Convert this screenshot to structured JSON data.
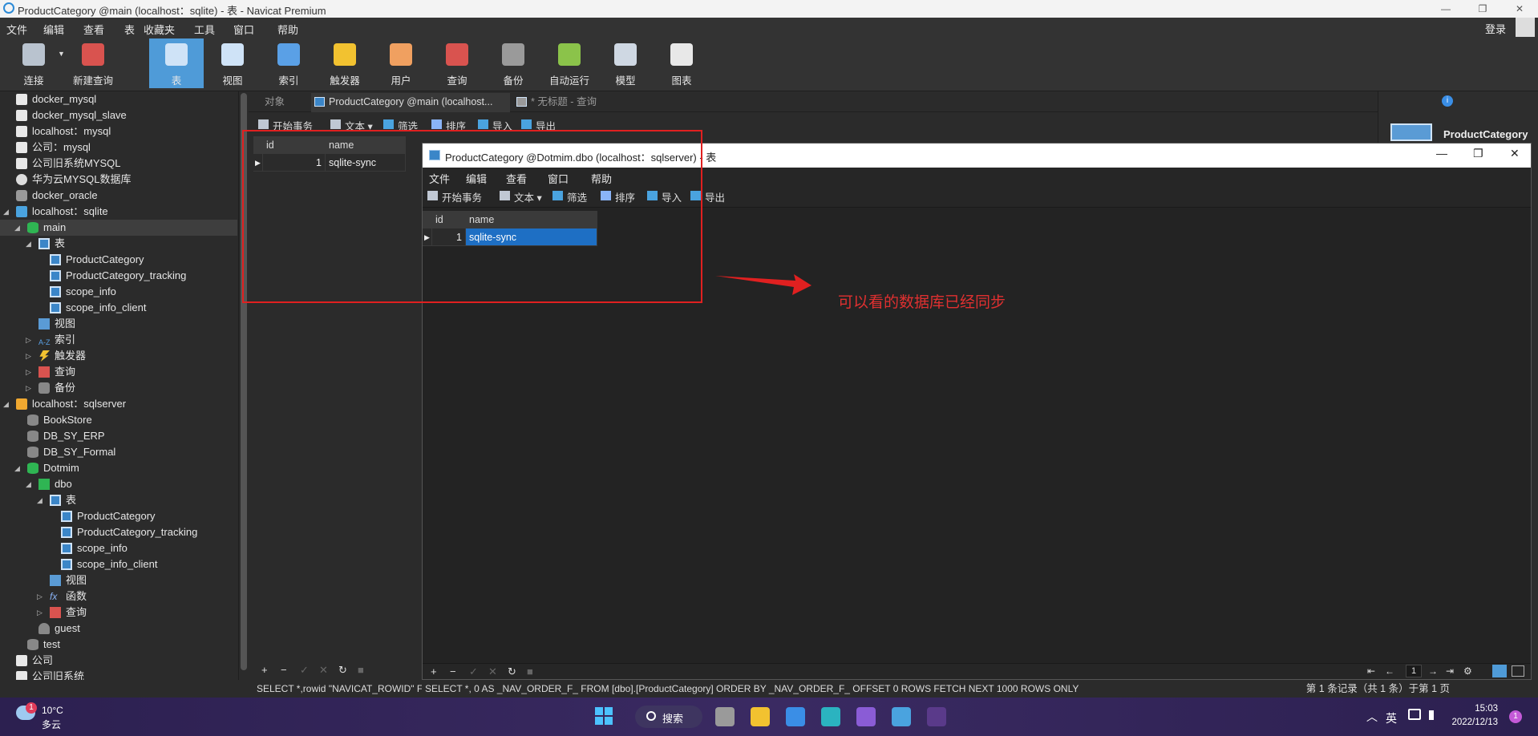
{
  "window": {
    "title": "ProductCategory @main (localhost：sqlite) - 表 - Navicat Premium",
    "minimize": "—",
    "maximize": "❐",
    "close": "✕"
  },
  "menu": [
    "文件",
    "编辑",
    "查看",
    "表",
    "收藏夹",
    "工具",
    "窗口",
    "帮助"
  ],
  "account": {
    "login": "登录"
  },
  "toolbar": [
    {
      "label": "连接",
      "icon": "plug-icon",
      "color": "#b9c3cf"
    },
    {
      "label": "新建查询",
      "icon": "new-query-icon",
      "color": "#d9534f"
    },
    {
      "label": "表",
      "icon": "table-icon",
      "color": "#cfe3f7",
      "active": true
    },
    {
      "label": "视图",
      "icon": "view-icon",
      "color": "#cfe3f7"
    },
    {
      "label": "索引",
      "icon": "index-icon",
      "color": "#5aa0e6"
    },
    {
      "label": "触发器",
      "icon": "trigger-icon",
      "color": "#f2c230"
    },
    {
      "label": "用户",
      "icon": "user-icon",
      "color": "#f0a060"
    },
    {
      "label": "查询",
      "icon": "query-icon",
      "color": "#d9534f"
    },
    {
      "label": "备份",
      "icon": "backup-icon",
      "color": "#9a9a9a"
    },
    {
      "label": "自动运行",
      "icon": "auto-run-icon",
      "color": "#8bc34a"
    },
    {
      "label": "模型",
      "icon": "model-icon",
      "color": "#cfd8e3"
    },
    {
      "label": "图表",
      "icon": "chart-icon",
      "color": "#e8e8e8"
    }
  ],
  "tree": [
    {
      "label": "docker_mysql",
      "icon": "conn",
      "indent": 0
    },
    {
      "label": "docker_mysql_slave",
      "icon": "conn",
      "indent": 0
    },
    {
      "label": "localhost：mysql",
      "icon": "conn",
      "indent": 0
    },
    {
      "label": "公司：mysql",
      "icon": "conn",
      "indent": 0
    },
    {
      "label": "公司旧系统MYSQL",
      "icon": "conn",
      "indent": 0
    },
    {
      "label": "华为云MYSQL数据库",
      "icon": "huawei",
      "indent": 0
    },
    {
      "label": "docker_oracle",
      "icon": "orcl",
      "indent": 0
    },
    {
      "label": "localhost：sqlite",
      "icon": "sqlite",
      "indent": 0,
      "arrow": "◢"
    },
    {
      "label": "main",
      "icon": "dbg",
      "indent": 1,
      "arrow": "◢",
      "selected": true
    },
    {
      "label": "表",
      "icon": "tbl",
      "indent": 2,
      "arrow": "◢"
    },
    {
      "label": "ProductCategory",
      "icon": "tbl",
      "indent": 3
    },
    {
      "label": "ProductCategory_tracking",
      "icon": "tbl",
      "indent": 3
    },
    {
      "label": "scope_info",
      "icon": "tbl",
      "indent": 3
    },
    {
      "label": "scope_info_client",
      "icon": "tbl",
      "indent": 3
    },
    {
      "label": "视图",
      "icon": "view",
      "indent": 2
    },
    {
      "label": "索引",
      "icon": "idx",
      "indent": 2,
      "arrow": "▷"
    },
    {
      "label": "触发器",
      "icon": "trig",
      "indent": 2,
      "arrow": "▷"
    },
    {
      "label": "查询",
      "icon": "query",
      "indent": 2,
      "arrow": "▷"
    },
    {
      "label": "备份",
      "icon": "backup",
      "indent": 2,
      "arrow": "▷"
    },
    {
      "label": "localhost：sqlserver",
      "icon": "sqlsrv",
      "indent": 0,
      "arrow": "◢"
    },
    {
      "label": "BookStore",
      "icon": "db",
      "indent": 1
    },
    {
      "label": "DB_SY_ERP",
      "icon": "db",
      "indent": 1
    },
    {
      "label": "DB_SY_Formal",
      "icon": "db",
      "indent": 1
    },
    {
      "label": "Dotmim",
      "icon": "dbg",
      "indent": 1,
      "arrow": "◢"
    },
    {
      "label": "dbo",
      "icon": "schema",
      "indent": 2,
      "arrow": "◢"
    },
    {
      "label": "表",
      "icon": "tbl",
      "indent": 3,
      "arrow": "◢"
    },
    {
      "label": "ProductCategory",
      "icon": "tbl",
      "indent": 4
    },
    {
      "label": "ProductCategory_tracking",
      "icon": "tbl",
      "indent": 4
    },
    {
      "label": "scope_info",
      "icon": "tbl",
      "indent": 4
    },
    {
      "label": "scope_info_client",
      "icon": "tbl",
      "indent": 4
    },
    {
      "label": "视图",
      "icon": "view",
      "indent": 3
    },
    {
      "label": "函数",
      "icon": "func",
      "indent": 3,
      "arrow": "▷"
    },
    {
      "label": "查询",
      "icon": "query",
      "indent": 3,
      "arrow": "▷"
    },
    {
      "label": "guest",
      "icon": "user",
      "indent": 2
    },
    {
      "label": "test",
      "icon": "db",
      "indent": 1
    },
    {
      "label": "公司",
      "icon": "conn",
      "indent": 0
    },
    {
      "label": "公司旧系统",
      "icon": "conn",
      "indent": 0
    }
  ],
  "tabs": [
    {
      "label": "对象",
      "active": false,
      "icon": false
    },
    {
      "label": "ProductCategory @main (localhost...",
      "active": true,
      "icon": true
    },
    {
      "label": "* 无标题 - 查询",
      "active": false,
      "icon": true
    }
  ],
  "subtoolbar": [
    "开始事务",
    "文本",
    "筛选",
    "排序",
    "导入",
    "导出"
  ],
  "grid_main": {
    "columns": [
      "id",
      "name"
    ],
    "rows": [
      [
        "1",
        "sqlite-sync"
      ]
    ]
  },
  "right_panel": {
    "title": "ProductCategory",
    "info": "i"
  },
  "subwindow": {
    "title": "ProductCategory @Dotmim.dbo (localhost：sqlserver) - 表",
    "menu": [
      "文件",
      "编辑",
      "查看",
      "窗口",
      "帮助"
    ],
    "toolbar": [
      "开始事务",
      "文本",
      "筛选",
      "排序",
      "导入",
      "导出"
    ],
    "grid": {
      "columns": [
        "id",
        "name"
      ],
      "rows": [
        [
          "1",
          "sqlite-sync"
        ]
      ]
    },
    "footer_buttons": [
      "+",
      "−",
      "✓",
      "✕",
      "↻",
      "■"
    ],
    "page": "1"
  },
  "annotation": {
    "text": "可以看的数据库已经同步",
    "color": "#e02020"
  },
  "status": {
    "left_sql": "SELECT *,rowid \"NAVICAT_ROWID\" FROM ...",
    "main_sql": "SELECT *, 0 AS _NAV_ORDER_F_ FROM [dbo].[ProductCategory] ORDER BY _NAV_ORDER_F_ OFFSET 0 ROWS FETCH NEXT 1000 ROWS ONLY",
    "records": "第 1 条记录（共 1 条）于第 1 页"
  },
  "left_footer_buttons": [
    "+",
    "−",
    "✓",
    "✕",
    "↻",
    "■"
  ],
  "taskbar": {
    "badge": "1",
    "temperature": "10°C",
    "condition": "多云",
    "search": "搜索",
    "lang": "英",
    "time": "15:03",
    "date": "2022/12/13",
    "notifications": "1",
    "apps": [
      {
        "name": "task-view-icon",
        "color": "#9a9a9a"
      },
      {
        "name": "file-explorer-icon",
        "color": "#f2c230"
      },
      {
        "name": "store-icon",
        "color": "#3a8ee6"
      },
      {
        "name": "edge-icon",
        "color": "#2bb3c0"
      },
      {
        "name": "visual-studio-icon",
        "color": "#8a5cd6"
      },
      {
        "name": "navicat-icon",
        "color": "#4aa3df"
      },
      {
        "name": "terminal-icon",
        "color": "#5a3a8a"
      }
    ]
  }
}
